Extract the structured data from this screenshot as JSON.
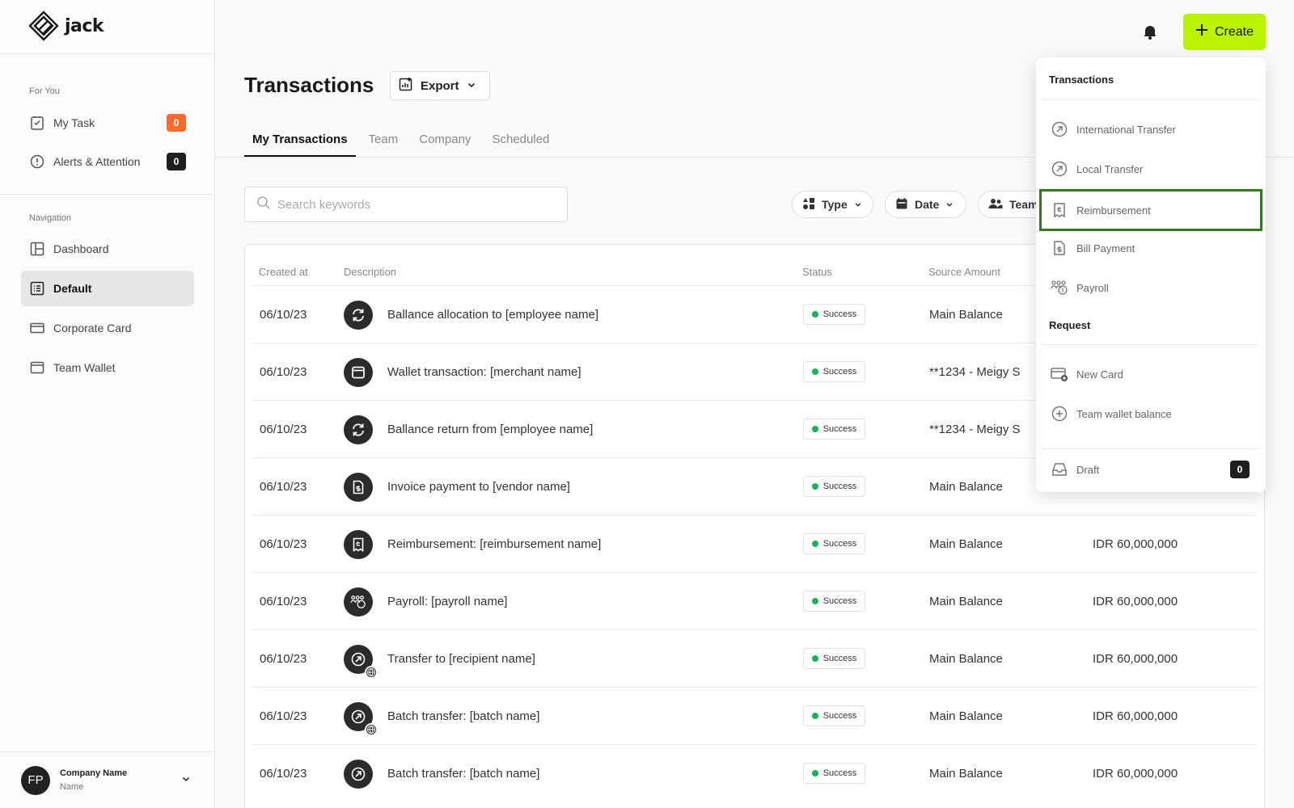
{
  "app": {
    "name": "jack"
  },
  "sidebar": {
    "for_you_label": "For You",
    "my_task": {
      "label": "My Task",
      "count": "0"
    },
    "alerts": {
      "label": "Alerts & Attention",
      "count": "0"
    },
    "navigation_label": "Navigation",
    "nav_items": [
      {
        "label": "Dashboard",
        "icon": "dashboard-icon"
      },
      {
        "label": "Default",
        "icon": "list-icon",
        "active": true
      },
      {
        "label": "Corporate Card",
        "icon": "card-icon"
      },
      {
        "label": "Team Wallet",
        "icon": "wallet-icon"
      }
    ],
    "footer": {
      "initials": "FP",
      "company": "Company Name",
      "name": "Name"
    }
  },
  "topbar": {
    "create_label": "Create",
    "accent": "#b9f300"
  },
  "page": {
    "title": "Transactions",
    "export_label": "Export",
    "tabs": [
      "My Transactions",
      "Team",
      "Company",
      "Scheduled"
    ],
    "active_tab": "My Transactions",
    "search_placeholder": "Search keywords",
    "filters": {
      "type": "Type",
      "date": "Date",
      "teams": "Teams"
    }
  },
  "table": {
    "columns": [
      "Created at",
      "Description",
      "Status",
      "Source Amount"
    ],
    "rows": [
      {
        "date": "06/10/23",
        "desc": "Ballance allocation to [employee name]",
        "status": "Success",
        "source": "Main Balance",
        "amount": "",
        "icon": "refresh-icon"
      },
      {
        "date": "06/10/23",
        "desc": "Wallet transaction: [merchant name]",
        "status": "Success",
        "source": "**1234 - Meigy S",
        "amount": "",
        "icon": "wallet-icon"
      },
      {
        "date": "06/10/23",
        "desc": "Ballance return from [employee name]",
        "status": "Success",
        "source": "**1234 - Meigy S",
        "amount": "",
        "icon": "refresh-icon"
      },
      {
        "date": "06/10/23",
        "desc": "Invoice payment to [vendor name]",
        "status": "Success",
        "source": "Main Balance",
        "amount": "",
        "icon": "invoice-icon"
      },
      {
        "date": "06/10/23",
        "desc": "Reimbursement: [reimbursement name]",
        "status": "Success",
        "source": "Main Balance",
        "amount": "IDR 60,000,000",
        "icon": "receipt-icon"
      },
      {
        "date": "06/10/23",
        "desc": "Payroll: [payroll name]",
        "status": "Success",
        "source": "Main Balance",
        "amount": "IDR 60,000,000",
        "icon": "payroll-icon"
      },
      {
        "date": "06/10/23",
        "desc": "Transfer to [recipient name]",
        "status": "Success",
        "source": "Main Balance",
        "amount": "IDR 60,000,000",
        "icon": "transfer-icon",
        "globe": true
      },
      {
        "date": "06/10/23",
        "desc": "Batch transfer: [batch name]",
        "status": "Success",
        "source": "Main Balance",
        "amount": "IDR 60,000,000",
        "icon": "transfer-icon",
        "globe": true
      },
      {
        "date": "06/10/23",
        "desc": "Batch transfer: [batch name]",
        "status": "Success",
        "source": "Main Balance",
        "amount": "IDR 60,000,000",
        "icon": "transfer-icon"
      }
    ]
  },
  "create_menu": {
    "transactions_header": "Transactions",
    "transactions": [
      {
        "label": "International Transfer",
        "icon": "arrow-circle-icon"
      },
      {
        "label": "Local Transfer",
        "icon": "arrow-circle-icon"
      },
      {
        "label": "Reimbursement",
        "icon": "receipt-icon",
        "highlighted": true
      },
      {
        "label": "Bill Payment",
        "icon": "invoice-icon"
      },
      {
        "label": "Payroll",
        "icon": "payroll-icon"
      }
    ],
    "request_header": "Request",
    "requests": [
      {
        "label": "New Card",
        "icon": "new-card-icon"
      },
      {
        "label": "Team wallet balance",
        "icon": "plus-circle-icon"
      }
    ],
    "draft": {
      "label": "Draft",
      "count": "0"
    }
  }
}
